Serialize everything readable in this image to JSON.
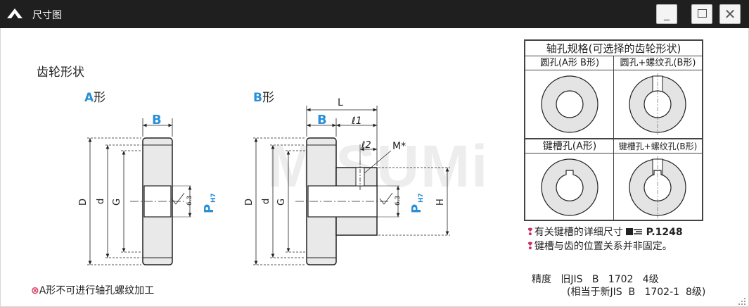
{
  "window": {
    "title": "尺寸图",
    "buttons": {
      "minimize": "_",
      "close": "✕"
    }
  },
  "drawing": {
    "section_title": "齿轮形状",
    "shape_a_letter": "A",
    "shape_b_letter": "B",
    "shape_suffix": "形",
    "watermark": "MiSUMi",
    "labels": {
      "B": "B",
      "L": "L",
      "l1": "ℓ1",
      "l2": "ℓ2",
      "M": "M*",
      "D": "D",
      "d": "d",
      "G": "G",
      "P": "P",
      "H7": "H7",
      "H": "H",
      "roughness": "6.3"
    },
    "bottom_note_icon": "⊗",
    "bottom_note": "A形不可进行轴孔螺纹加工"
  },
  "spec_table": {
    "title": "轴孔规格(可选择的齿轮形状)",
    "cells": [
      {
        "label": "圆孔(A形 B形)"
      },
      {
        "label": "圆孔+螺纹孔(B形)"
      },
      {
        "label": "键槽孔(A形)"
      },
      {
        "label": "键槽孔+螺纹孔(B形)"
      }
    ]
  },
  "info": {
    "pin_icon": "❢",
    "line1": "有关键槽的详细尺寸",
    "line1_ref": "P.1248",
    "line2": "键槽与齿的位置关系并非固定。"
  },
  "precision": {
    "line1": "精度   旧JIS   B   1702   4级",
    "line2": "(相当于新JIS  B   1702-1  8级)"
  }
}
